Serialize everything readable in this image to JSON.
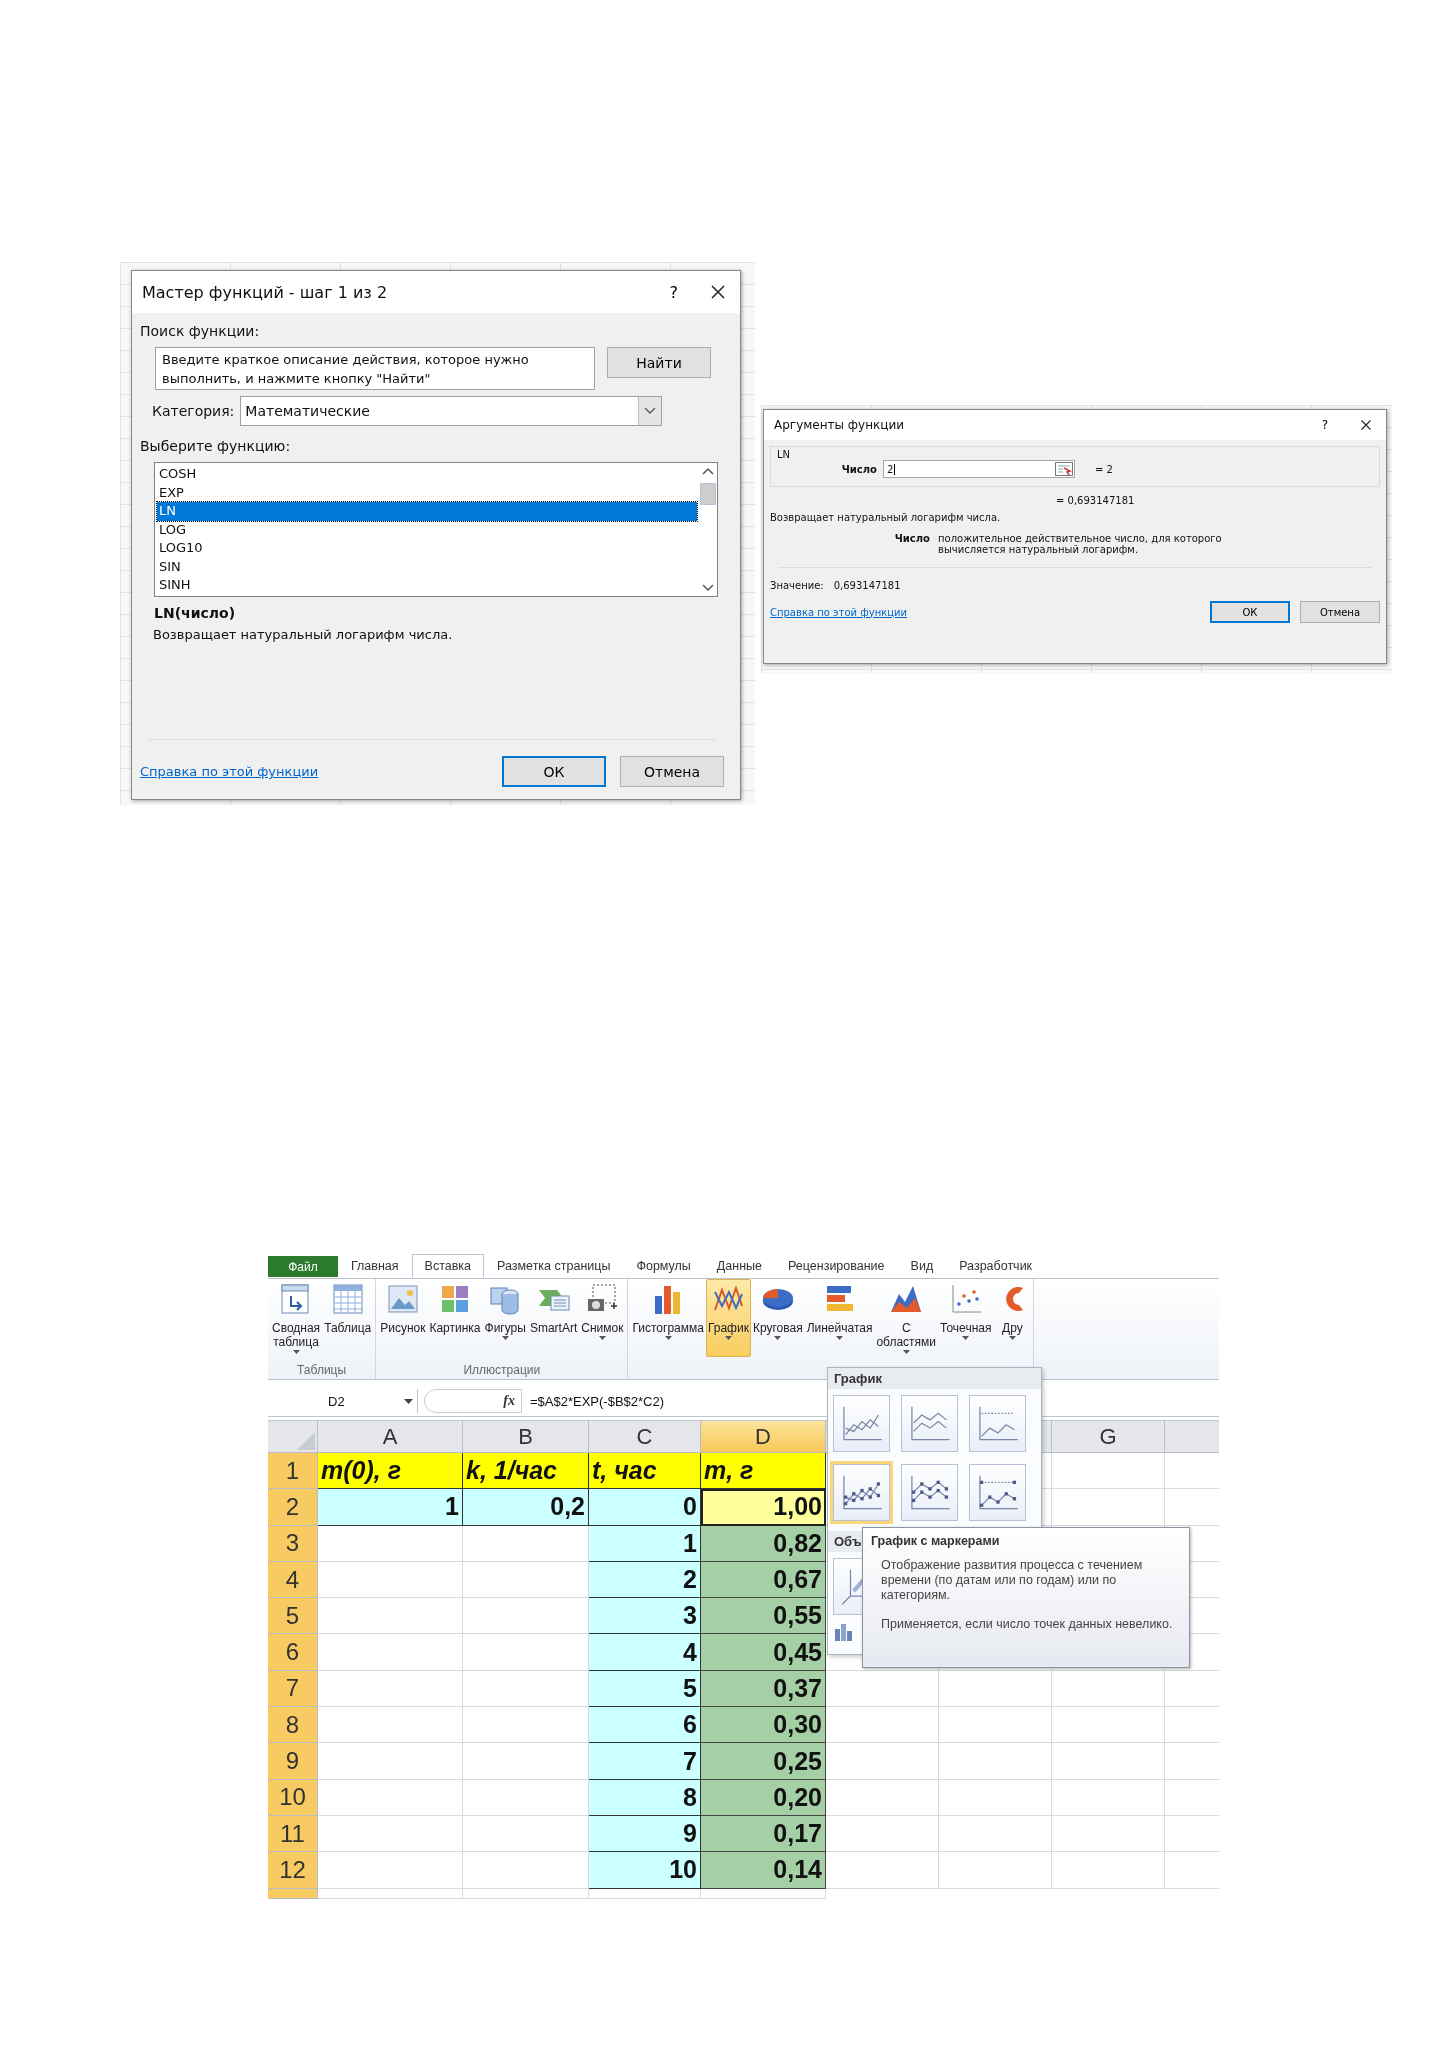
{
  "function_wizard": {
    "title": "Мастер функций - шаг 1 из 2",
    "help": "?",
    "search_label": "Поиск функции:",
    "search_value": "Введите краткое описание действия, которое нужно выполнить, и нажмите кнопку \"Найти\"",
    "find_button": "Найти",
    "category_label": "Категория:",
    "category_value": "Математические",
    "list_label": "Выберите функцию:",
    "functions": [
      {
        "name": "COSH",
        "selected": false
      },
      {
        "name": "EXP",
        "selected": false
      },
      {
        "name": "LN",
        "selected": true
      },
      {
        "name": "LOG",
        "selected": false
      },
      {
        "name": "LOG10",
        "selected": false
      },
      {
        "name": "SIN",
        "selected": false
      },
      {
        "name": "SINH",
        "selected": false
      }
    ],
    "signature": "LN(число)",
    "description": "Возвращает натуральный логарифм числа.",
    "help_link": "Справка по этой функции",
    "ok": "ОК",
    "cancel": "Отмена"
  },
  "function_arguments": {
    "title": "Аргументы функции",
    "help": "?",
    "function_name": "LN",
    "arg_label": "Число",
    "arg_value": "2",
    "arg_result": "=  2",
    "result": "=  0,693147181",
    "description": "Возвращает натуральный логарифм числа.",
    "arg_desc_label": "Число",
    "arg_desc": "положительное действительное число, для которого вычисляется натуральный логарифм.",
    "value_label": "Значение:",
    "value": "0,693147181",
    "help_link": "Справка по этой функции",
    "ok": "ОК",
    "cancel": "Отмена"
  },
  "excel": {
    "file_tab": "Файл",
    "tabs": [
      {
        "label": "Главная",
        "selected": false
      },
      {
        "label": "Вставка",
        "selected": true
      },
      {
        "label": "Разметка страницы",
        "selected": false
      },
      {
        "label": "Формулы",
        "selected": false
      },
      {
        "label": "Данные",
        "selected": false
      },
      {
        "label": "Рецензирование",
        "selected": false
      },
      {
        "label": "Вид",
        "selected": false
      },
      {
        "label": "Разработчик",
        "selected": false
      }
    ],
    "groups": [
      {
        "label": "Таблицы",
        "items": [
          {
            "kind": "pivot",
            "lines": [
              "Сводная",
              "таблица"
            ],
            "dropdown": true,
            "selected": false
          },
          {
            "kind": "table",
            "lines": [
              "Таблица"
            ],
            "dropdown": false,
            "selected": false
          }
        ]
      },
      {
        "label": "Иллюстрации",
        "items": [
          {
            "kind": "picture",
            "lines": [
              "Рисунок"
            ],
            "dropdown": false,
            "selected": false
          },
          {
            "kind": "clipart",
            "lines": [
              "Картинка"
            ],
            "dropdown": false,
            "selected": false
          },
          {
            "kind": "shapes",
            "lines": [
              "Фигуры"
            ],
            "dropdown": true,
            "selected": false
          },
          {
            "kind": "smartart",
            "lines": [
              "SmartArt"
            ],
            "dropdown": false,
            "selected": false
          },
          {
            "kind": "screenshot",
            "lines": [
              "Снимок"
            ],
            "dropdown": true,
            "selected": false
          }
        ]
      },
      {
        "items": [
          {
            "kind": "column",
            "lines": [
              "Гистограмма"
            ],
            "dropdown": true,
            "selected": false
          },
          {
            "kind": "line",
            "lines": [
              "График"
            ],
            "dropdown": true,
            "selected": true
          },
          {
            "kind": "pie",
            "lines": [
              "Круговая"
            ],
            "dropdown": true,
            "selected": false
          },
          {
            "kind": "bar",
            "lines": [
              "Линейчатая"
            ],
            "dropdown": true,
            "selected": false
          },
          {
            "kind": "area",
            "lines": [
              "С",
              "областями"
            ],
            "dropdown": true,
            "selected": false
          },
          {
            "kind": "scatter",
            "lines": [
              "Точечная"
            ],
            "dropdown": true,
            "selected": false
          },
          {
            "kind": "other",
            "lines": [
              "Дру"
            ],
            "dropdown": true,
            "selected": false
          }
        ]
      }
    ],
    "name_box": "D2",
    "fx": "fx",
    "formula": "=$A$2*EXP(-$B$2*C2)",
    "columns": [
      {
        "label": "A",
        "selected": false
      },
      {
        "label": "B",
        "selected": false
      },
      {
        "label": "C",
        "selected": false
      },
      {
        "label": "D",
        "selected": true
      }
    ],
    "right_columns": [
      {
        "label": "G",
        "selected": false
      }
    ],
    "rows": [
      {
        "header": "1",
        "selected": true,
        "cells": [
          {
            "kind": "header",
            "text": "m(0), г"
          },
          {
            "kind": "header",
            "text": "k, 1/час"
          },
          {
            "kind": "header",
            "text": "t, час"
          },
          {
            "kind": "header",
            "text": "m, г"
          }
        ]
      },
      {
        "header": "2",
        "selected": true,
        "cells": [
          {
            "kind": "input",
            "text": "1"
          },
          {
            "kind": "input",
            "text": "0,2"
          },
          {
            "kind": "input",
            "text": "0"
          },
          {
            "kind": "active",
            "text": "1,00"
          }
        ]
      },
      {
        "header": "3",
        "selected": true,
        "cells": [
          {
            "kind": "empty"
          },
          {
            "kind": "empty"
          },
          {
            "kind": "input",
            "text": "1"
          },
          {
            "kind": "result",
            "text": "0,82"
          }
        ]
      },
      {
        "header": "4",
        "selected": true,
        "cells": [
          {
            "kind": "empty"
          },
          {
            "kind": "empty"
          },
          {
            "kind": "input",
            "text": "2"
          },
          {
            "kind": "result",
            "text": "0,67"
          }
        ]
      },
      {
        "header": "5",
        "selected": true,
        "cells": [
          {
            "kind": "empty"
          },
          {
            "kind": "empty"
          },
          {
            "kind": "input",
            "text": "3"
          },
          {
            "kind": "result",
            "text": "0,55"
          }
        ]
      },
      {
        "header": "6",
        "selected": true,
        "cells": [
          {
            "kind": "empty"
          },
          {
            "kind": "empty"
          },
          {
            "kind": "input",
            "text": "4"
          },
          {
            "kind": "result",
            "text": "0,45"
          }
        ]
      },
      {
        "header": "7",
        "selected": true,
        "cells": [
          {
            "kind": "empty"
          },
          {
            "kind": "empty"
          },
          {
            "kind": "input",
            "text": "5"
          },
          {
            "kind": "result",
            "text": "0,37"
          }
        ]
      },
      {
        "header": "8",
        "selected": true,
        "cells": [
          {
            "kind": "empty"
          },
          {
            "kind": "empty"
          },
          {
            "kind": "input",
            "text": "6"
          },
          {
            "kind": "result",
            "text": "0,30"
          }
        ]
      },
      {
        "header": "9",
        "selected": true,
        "cells": [
          {
            "kind": "empty"
          },
          {
            "kind": "empty"
          },
          {
            "kind": "input",
            "text": "7"
          },
          {
            "kind": "result",
            "text": "0,25"
          }
        ]
      },
      {
        "header": "10",
        "selected": true,
        "cells": [
          {
            "kind": "empty"
          },
          {
            "kind": "empty"
          },
          {
            "kind": "input",
            "text": "8"
          },
          {
            "kind": "result",
            "text": "0,20"
          }
        ]
      },
      {
        "header": "11",
        "selected": true,
        "cells": [
          {
            "kind": "empty"
          },
          {
            "kind": "empty"
          },
          {
            "kind": "input",
            "text": "9"
          },
          {
            "kind": "result",
            "text": "0,17"
          }
        ]
      },
      {
        "header": "12",
        "selected": true,
        "cells": [
          {
            "kind": "empty"
          },
          {
            "kind": "empty"
          },
          {
            "kind": "input",
            "text": "10"
          },
          {
            "kind": "result",
            "text": "0,14"
          }
        ]
      }
    ],
    "gallery": {
      "title": "График",
      "thumbs": [
        {
          "kind": "plain",
          "selected": false
        },
        {
          "kind": "stacked",
          "selected": false
        },
        {
          "kind": "percent",
          "selected": false
        },
        {
          "kind": "plain_markers",
          "selected": true
        },
        {
          "kind": "stacked_markers",
          "selected": false
        },
        {
          "kind": "percent_markers",
          "selected": false
        }
      ],
      "section_title": "Объ"
    },
    "tooltip": {
      "title": "График с маркерами",
      "paragraphs": [
        "Отображение развития процесса с течением времени (по датам или по годам) или по категориям.",
        "Применяется, если число точек данных невелико."
      ]
    }
  }
}
